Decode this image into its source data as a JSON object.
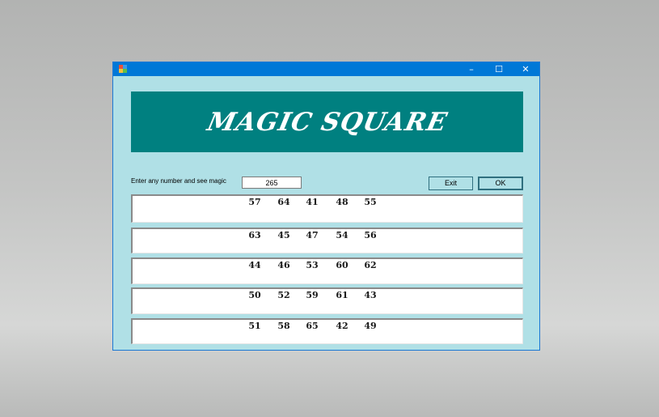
{
  "window": {
    "title_icon": "app-icon",
    "controls": {
      "minimize": "–",
      "maximize": "☐",
      "close": "✕"
    }
  },
  "banner": {
    "title": "MAGIC SQUARE"
  },
  "input": {
    "label": "Enter any number and see magic",
    "value": "265"
  },
  "buttons": {
    "exit": "Exit",
    "ok": "OK"
  },
  "grid": [
    [
      "57",
      "64",
      "41",
      "48",
      "55"
    ],
    [
      "63",
      "45",
      "47",
      "54",
      "56"
    ],
    [
      "44",
      "46",
      "53",
      "60",
      "62"
    ],
    [
      "50",
      "52",
      "59",
      "61",
      "43"
    ],
    [
      "51",
      "58",
      "65",
      "42",
      "49"
    ]
  ],
  "colors": {
    "banner": "#008080",
    "client": "#b0e0e6",
    "titlebar": "#0078d7"
  }
}
